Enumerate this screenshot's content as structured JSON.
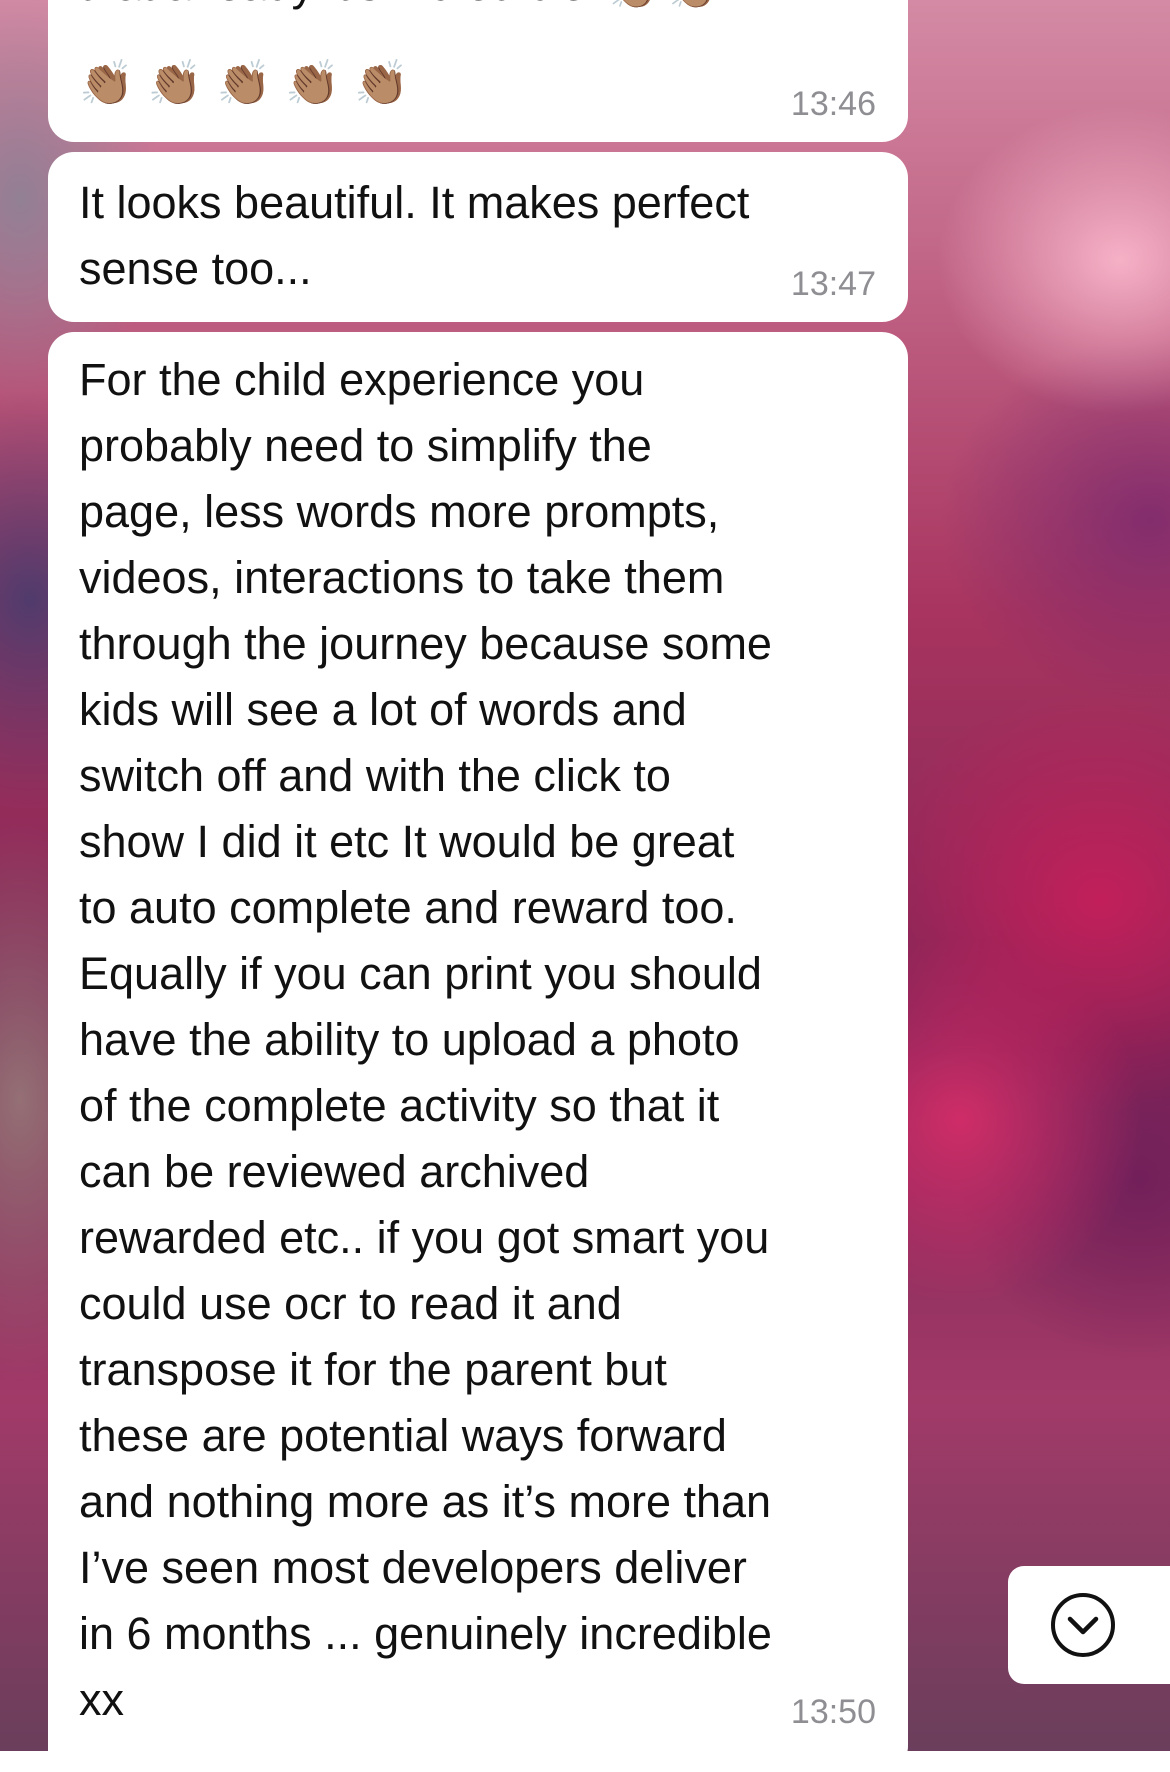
{
  "messages": [
    {
      "text": "that already it’s incredible",
      "inline_emoji": "👏🏽👏🏽",
      "emoji_row": "👏🏽👏🏽👏🏽👏🏽👏🏽",
      "time": "13:46"
    },
    {
      "text": "It looks beautiful. It makes perfect\nsense too...",
      "time": "13:47"
    },
    {
      "text": "For the child experience you\nprobably need to simplify the\npage, less words more prompts,\nvideos, interactions to take them\nthrough the journey because some\nkids will see a lot of words and\nswitch off and with the click to\nshow I did it etc   It would be great\nto auto complete and reward too.\nEqually if you can print you should\nhave the ability to upload a photo\nof the complete activity so that it\ncan be reviewed archived\nrewarded etc.. if you got smart you\ncould use ocr to read it and\ntranspose it for the parent but\nthese are potential ways forward\nand nothing more as it’s more than\nI’ve seen most developers deliver\nin 6 months ... genuinely incredible\nxx",
      "time": "13:50"
    }
  ],
  "scroll_button": {
    "icon": "chevron-down-circle-icon"
  },
  "colors": {
    "bubble": "#ffffff",
    "text": "#111111",
    "timestamp": "#8e8e93",
    "wallpaper_accent": "#c42a6a"
  }
}
